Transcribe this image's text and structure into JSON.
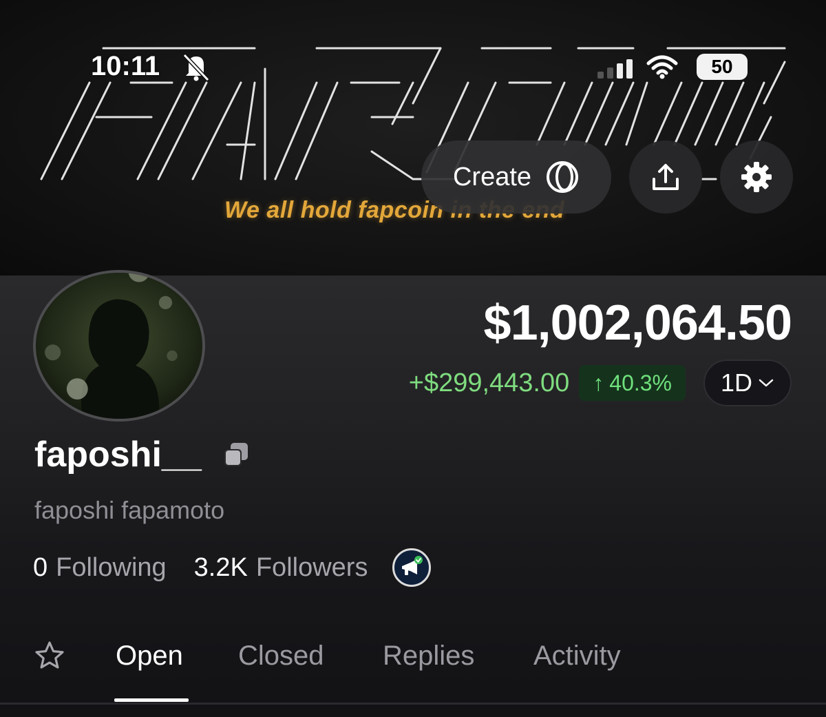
{
  "status_bar": {
    "time": "10:11",
    "battery": "50",
    "icons": [
      "bell-slash-icon",
      "signal-icon",
      "wifi-icon",
      "battery-icon"
    ]
  },
  "banner": {
    "logo_text": "FAPCOIN",
    "tagline": "We all hold fapcoin in the end",
    "tagline_color": "#e3a73a"
  },
  "actions": {
    "create_label": "Create",
    "create_icon": "coin-icon",
    "share_icon": "share-icon",
    "settings_icon": "gear-icon"
  },
  "profile": {
    "balance": "$1,002,064.50",
    "pnl_amount": "+$299,443.00",
    "pnl_percent": "40.3%",
    "pnl_arrow": "↑",
    "range": "1D",
    "username": "faposhi__",
    "display_name": "faposhi fapamoto",
    "following_count": "0",
    "following_label": "Following",
    "followers_count": "3.2K",
    "followers_label": "Followers",
    "badge_icon": "megaphone-badge-icon"
  },
  "tabs": {
    "favorites_icon": "star-icon",
    "items": [
      "Open",
      "Closed",
      "Replies",
      "Activity"
    ],
    "active": "Open"
  },
  "colors": {
    "positive": "#7fdc7f",
    "positive_bg": "#15331c",
    "background": "#131316"
  }
}
